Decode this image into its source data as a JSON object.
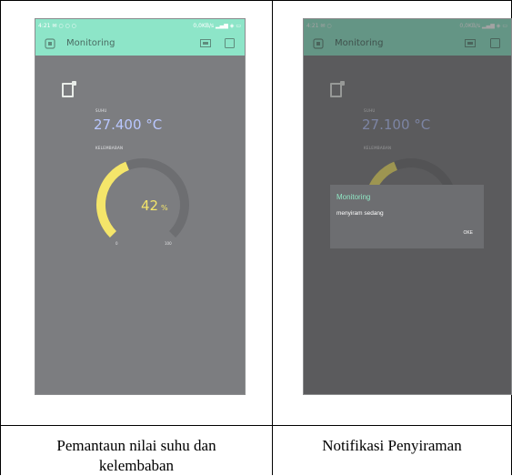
{
  "colors": {
    "app_bar": "#8de5c8",
    "screen_bg": "#7c7d80",
    "gauge_fill": "#f4e56a",
    "gauge_track": "#6d6e71",
    "temp_text": "#b9c7ff",
    "dialog_title": "#8fe6c4"
  },
  "left_screen": {
    "status_left": "4:21 ✉ ○ ○ ○",
    "status_right": "0,0KB/s ▂▄▆ ◈ ▭",
    "app_title": "Monitoring",
    "widget_icon": "tablet-icon",
    "temp_label": "SUHU",
    "temp_value": "27.400 °C",
    "humidity_label": "KELEMBABAN",
    "humidity_percent": 42,
    "humidity_value": "42",
    "humidity_unit": "%",
    "gauge_min": "0",
    "gauge_max": "100"
  },
  "right_screen": {
    "status_left": "4:21 ✉ ○",
    "status_right": "0,0KB/s ▂▄▆ ◈ ▭",
    "app_title": "Monitoring",
    "temp_label": "SUHU",
    "temp_value": "27.100 °C",
    "humidity_label": "KELEMBABAN",
    "dialog_title": "Monitoring",
    "dialog_message": "menyiram sedang",
    "dialog_ok": "OKE"
  },
  "captions": {
    "left_line1": "Pemantaun nilai suhu dan",
    "left_line2": "kelembaban",
    "right": "Notifikasi Penyiraman"
  }
}
